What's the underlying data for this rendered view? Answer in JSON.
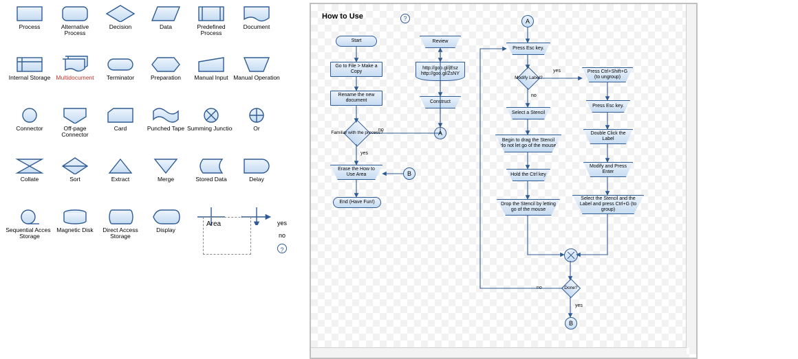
{
  "page_title": "How to Use",
  "help_glyph": "?",
  "palette_rows": [
    [
      "Process",
      "Alternative Process",
      "Decision",
      "Data",
      "Predefined Process",
      "Document"
    ],
    [
      "Internal Storage",
      "Multidocument",
      "Terminator",
      "Preparation",
      "Manual Input",
      "Manual Operation"
    ],
    [
      "Connector",
      "Off-page Connector",
      "Card",
      "Punched Tape",
      "Summing Junction",
      "Or"
    ],
    [
      "Collate",
      "Sort",
      "Extract",
      "Merge",
      "Stored Data",
      "Delay"
    ],
    [
      "Sequential Access Storage",
      "Magnetic Disk",
      "Direct Access Storage",
      "Display",
      "",
      ""
    ]
  ],
  "palette_highlight": "Multidocument",
  "area_box_label": "Area",
  "legend": {
    "yes": "yes",
    "no": "no"
  },
  "nodes": {
    "start": {
      "text": "Start"
    },
    "goto": {
      "text": "Go to File > Make a Copy"
    },
    "rename": {
      "text": "Rename the new document"
    },
    "familiar": {
      "text": "Familiar with the process?"
    },
    "erase": {
      "text": "Erase the How to Use Area"
    },
    "end": {
      "text": "End (Have Fun!)"
    },
    "review": {
      "text": "Review"
    },
    "urls": {
      "text": "http://goo.gl/jEsz  http://goo.gl/ZsNY"
    },
    "construct": {
      "text": "Construct"
    },
    "conA1": {
      "text": "A"
    },
    "conB1": {
      "text": "B"
    },
    "conA2": {
      "text": "A"
    },
    "pressEsc1": {
      "text": "Press Esc key."
    },
    "modifyLabel": {
      "text": "Modify Label?"
    },
    "selectStencil": {
      "text": "Select a Stencil"
    },
    "beginDrag": {
      "text": "Begin to drag the Stencil (do not let go of the mouse)"
    },
    "holdCtrl": {
      "text": "Hold the Ctrl key"
    },
    "dropStencil": {
      "text": "Drop the Stencil by letting go of the mouse"
    },
    "ctrlShiftG": {
      "text": "Press Ctrl+Shift+G (to ungroup)"
    },
    "pressEsc2": {
      "text": "Press Esc key."
    },
    "dblClick": {
      "text": "Double Click the Label"
    },
    "modifyEnter": {
      "text": "Modify and Press Enter"
    },
    "selectGroup": {
      "text": "Select the Stencil and the Label and press Ctrl+G (to group)"
    },
    "done": {
      "text": "Done?"
    },
    "conB2": {
      "text": "B"
    }
  },
  "edge_labels": {
    "familiar_yes": "yes",
    "familiar_no": "no",
    "modify_yes": "yes",
    "modify_no": "no",
    "done_yes": "yes",
    "done_no": "no"
  }
}
